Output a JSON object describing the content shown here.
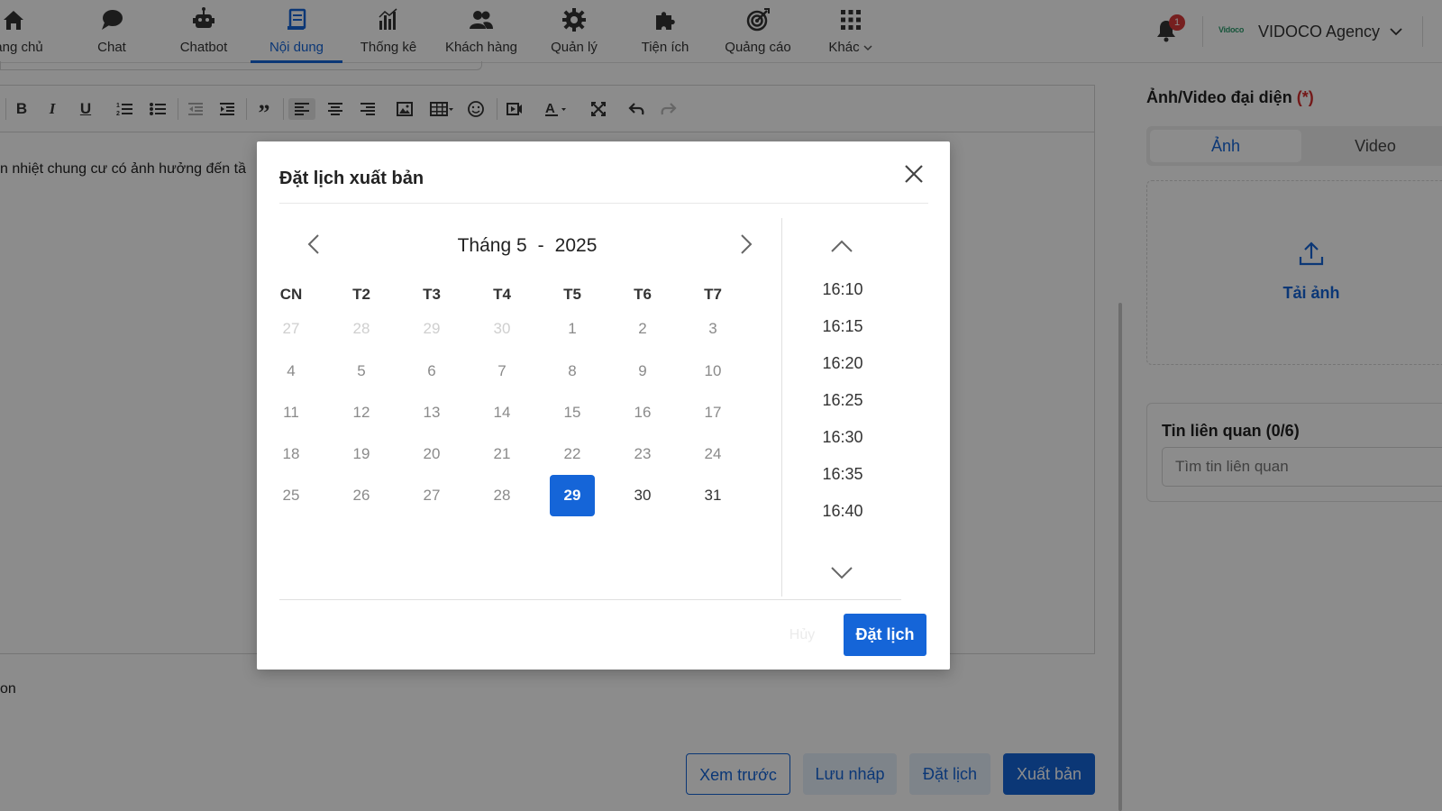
{
  "nav": {
    "items": [
      {
        "label": "ang chủ",
        "icon": "home-icon"
      },
      {
        "label": "Chat",
        "icon": "chat-icon"
      },
      {
        "label": "Chatbot",
        "icon": "robot-icon"
      },
      {
        "label": "Nội dung",
        "icon": "document-icon"
      },
      {
        "label": "Thống kê",
        "icon": "bar-chart-icon"
      },
      {
        "label": "Khách hàng",
        "icon": "users-icon"
      },
      {
        "label": "Quản lý",
        "icon": "gear-icon"
      },
      {
        "label": "Tiện ích",
        "icon": "puzzle-icon"
      },
      {
        "label": "Quảng cáo",
        "icon": "target-icon"
      },
      {
        "label": "Khác",
        "icon": "grid-icon"
      }
    ],
    "active": "Nội dung",
    "notification_count": "1",
    "agency_logo_text": "Vidoco",
    "agency_name": "VIDOCO Agency"
  },
  "editor": {
    "body_snippet": "n nhiệt chung cư có ảnh hưởng đến tầ",
    "footer_snippet": "on"
  },
  "actions": {
    "preview": "Xem trước",
    "draft": "Lưu nháp",
    "schedule": "Đặt lịch",
    "publish": "Xuất bản"
  },
  "right_panel": {
    "media_title": "Ảnh/Video đại diện",
    "required_mark": "(*)",
    "tab_image": "Ảnh",
    "tab_video": "Video",
    "upload_label": "Tải ảnh",
    "related_title": "Tin liên quan (0/6)",
    "related_placeholder": "Tìm tin liên quan"
  },
  "modal": {
    "title": "Đặt lịch xuất bản",
    "month_label": "Tháng 5",
    "separator": "-",
    "year": "2025",
    "weekdays": [
      "CN",
      "T2",
      "T3",
      "T4",
      "T5",
      "T6",
      "T7"
    ],
    "weeks": [
      [
        "27",
        "28",
        "29",
        "30",
        "1",
        "2",
        "3"
      ],
      [
        "4",
        "5",
        "6",
        "7",
        "8",
        "9",
        "10"
      ],
      [
        "11",
        "12",
        "13",
        "14",
        "15",
        "16",
        "17"
      ],
      [
        "18",
        "19",
        "20",
        "21",
        "22",
        "23",
        "24"
      ],
      [
        "25",
        "26",
        "27",
        "28",
        "29",
        "30",
        "31"
      ]
    ],
    "selected_day": "29",
    "times": [
      "16:10",
      "16:15",
      "16:20",
      "16:25",
      "16:30",
      "16:35",
      "16:40"
    ],
    "cancel_label": "Hủy",
    "confirm_label": "Đặt lịch"
  },
  "colors": {
    "accent": "#1565d8",
    "required": "#d32f2f",
    "badge": "#d73a3a"
  }
}
